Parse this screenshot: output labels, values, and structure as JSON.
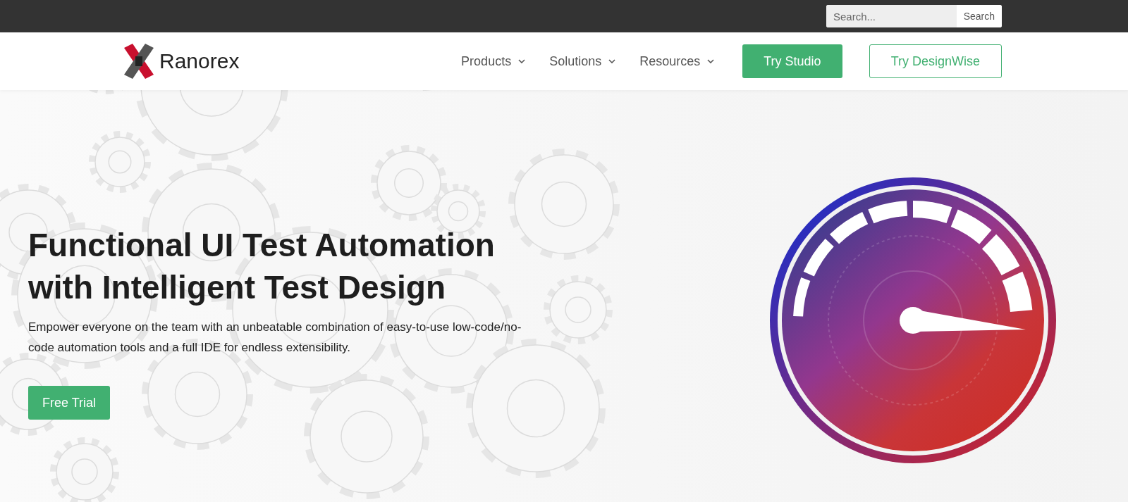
{
  "top_bar": {
    "search": {
      "placeholder": "Search...",
      "button": "Search"
    }
  },
  "header": {
    "logo": "Ranorex",
    "nav": [
      {
        "label": "Products",
        "has_menu": true
      },
      {
        "label": "Solutions",
        "has_menu": true
      },
      {
        "label": "Resources",
        "has_menu": true
      }
    ],
    "buttons": [
      {
        "label": "Try Studio",
        "kind": "primary"
      },
      {
        "label": "Try DesignWise",
        "kind": "outline"
      }
    ]
  },
  "hero": {
    "heading": "Functional UI Test Automation with Intelligent Test Design",
    "description": "Empower everyone on the team with an unbeatable combination of easy-to-use low-code/no-code automation tools and a full IDE for endless extensibility.",
    "cta": "Free Trial"
  }
}
